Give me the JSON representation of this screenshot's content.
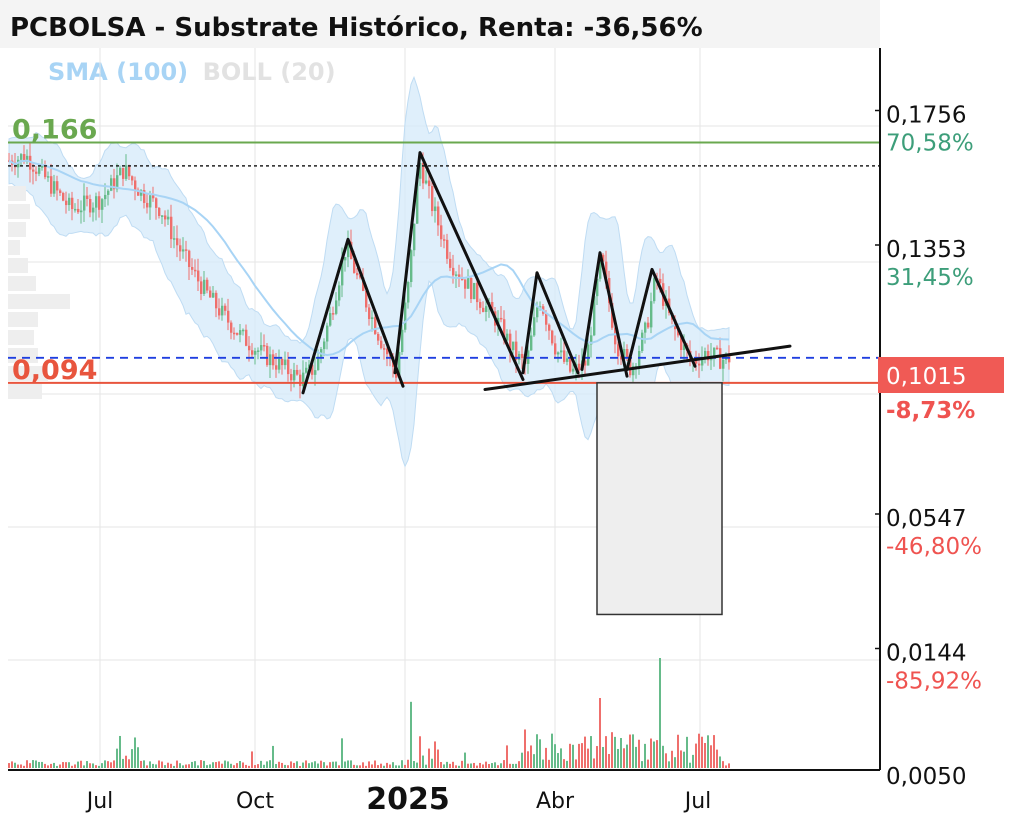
{
  "title": "PCBOLSA - Substrate Histórico, Renta: -36,56%",
  "legend": {
    "sma": "SMA (100)",
    "boll": "BOLL (20)"
  },
  "colors": {
    "up": "#66bb8a",
    "down": "#ef6f6c",
    "sma": "#a8d4f5",
    "band": "#d7ebfa",
    "support": "#e8553e",
    "resistance": "#6aa84f",
    "current": "#1f3fe0",
    "badge": "#f05a55"
  },
  "chart_data": {
    "type": "candlestick",
    "title": "PCBOLSA - Substrate Histórico, Renta: -36,56%",
    "x_ticks": [
      "Jul",
      "Oct",
      "2025",
      "Abr",
      "Jul"
    ],
    "y_ticks": [
      {
        "value": 0.1756,
        "label": "0,1756",
        "pct": "70,58%"
      },
      {
        "value": 0.1353,
        "label": "0,1353",
        "pct": "31,45%"
      },
      {
        "value": 0.0547,
        "label": "0,0547",
        "pct": "-46,80%"
      },
      {
        "value": 0.0144,
        "label": "0,0144",
        "pct": "-85,92%"
      }
    ],
    "y_range": [
      -0.005,
      0.19
    ],
    "y_bottom_label_partial": "0,0050",
    "current_price": {
      "value": 0.1015,
      "label": "0,1015",
      "pct": "-8,73%"
    },
    "levels": {
      "resistance": {
        "value": 0.166,
        "label": "0,166"
      },
      "support": {
        "value": 0.094,
        "label": "0,094"
      },
      "dotted_high": 0.159
    },
    "price_path": [
      [
        0,
        0.16
      ],
      [
        25,
        0.162
      ],
      [
        45,
        0.155
      ],
      [
        70,
        0.146
      ],
      [
        100,
        0.149
      ],
      [
        123,
        0.158
      ],
      [
        140,
        0.151
      ],
      [
        160,
        0.146
      ],
      [
        175,
        0.136
      ],
      [
        190,
        0.128
      ],
      [
        205,
        0.121
      ],
      [
        220,
        0.115
      ],
      [
        240,
        0.108
      ],
      [
        260,
        0.103
      ],
      [
        280,
        0.099
      ],
      [
        300,
        0.095
      ],
      [
        315,
        0.099
      ],
      [
        330,
        0.115
      ],
      [
        345,
        0.135
      ],
      [
        360,
        0.122
      ],
      [
        378,
        0.108
      ],
      [
        395,
        0.097
      ],
      [
        408,
        0.125
      ],
      [
        418,
        0.161
      ],
      [
        430,
        0.148
      ],
      [
        450,
        0.13
      ],
      [
        470,
        0.122
      ],
      [
        495,
        0.113
      ],
      [
        515,
        0.102
      ],
      [
        525,
        0.099
      ],
      [
        538,
        0.12
      ],
      [
        555,
        0.104
      ],
      [
        570,
        0.097
      ],
      [
        585,
        0.1
      ],
      [
        600,
        0.132
      ],
      [
        615,
        0.106
      ],
      [
        630,
        0.098
      ],
      [
        645,
        0.11
      ],
      [
        655,
        0.126
      ],
      [
        670,
        0.112
      ],
      [
        690,
        0.1
      ],
      [
        705,
        0.103
      ],
      [
        720,
        0.101
      ],
      [
        730,
        0.1015
      ]
    ],
    "trendlines": [
      [
        [
          303,
          0.091
        ],
        [
          348,
          0.137
        ],
        [
          403,
          0.093
        ]
      ],
      [
        [
          395,
          0.097
        ],
        [
          420,
          0.163
        ],
        [
          523,
          0.095
        ]
      ],
      [
        [
          523,
          0.097
        ],
        [
          537,
          0.127
        ],
        [
          578,
          0.097
        ]
      ],
      [
        [
          582,
          0.098
        ],
        [
          600,
          0.133
        ],
        [
          627,
          0.096
        ]
      ],
      [
        [
          627,
          0.098
        ],
        [
          652,
          0.128
        ],
        [
          695,
          0.099
        ]
      ],
      [
        [
          485,
          0.092
        ],
        [
          790,
          0.105
        ]
      ]
    ],
    "projection_box": {
      "x0": 597,
      "x1": 722,
      "top": 0.094,
      "bottom": 0.0246
    },
    "series": [
      {
        "name": "SMA (100)"
      },
      {
        "name": "BOLL (20)"
      }
    ]
  }
}
